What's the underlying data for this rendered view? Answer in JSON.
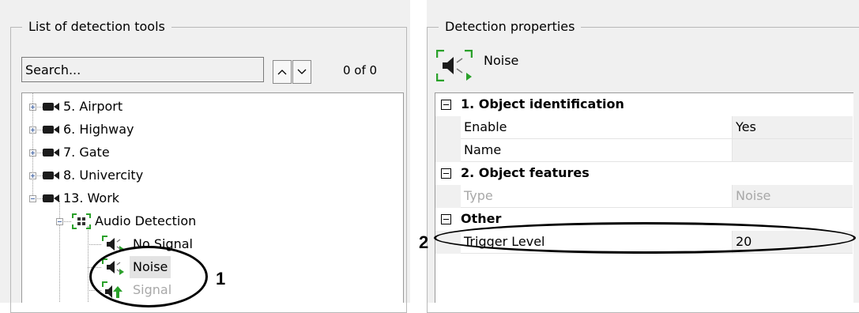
{
  "left_panel": {
    "title": "List of detection tools",
    "search_placeholder": "Search...",
    "up_arrow": "^",
    "down_arrow": "v",
    "result_count": "0 of 0",
    "tree": [
      {
        "label": "5. Airport",
        "expander": "plus",
        "icon": "camera-icon"
      },
      {
        "label": "6. Highway",
        "expander": "plus",
        "icon": "camera-icon"
      },
      {
        "label": "7. Gate",
        "expander": "plus",
        "icon": "camera-icon"
      },
      {
        "label": "8. Univercity",
        "expander": "plus",
        "icon": "camera-icon"
      },
      {
        "label": "13. Work",
        "expander": "minus",
        "icon": "camera-icon"
      },
      {
        "label": "Audio Detection",
        "expander": "minus",
        "icon": "audio-detection-icon"
      },
      {
        "label": "No Signal",
        "icon": "no-signal-speaker-icon"
      },
      {
        "label": "Noise",
        "icon": "noise-speaker-icon",
        "selected": true
      },
      {
        "label": "Signal",
        "icon": "signal-speaker-icon",
        "disabled": true
      }
    ]
  },
  "right_panel": {
    "title": "Detection properties",
    "header_label": "Noise",
    "header_icon": "noise-detector-icon",
    "categories": [
      {
        "label": "1. Object identification",
        "rows": [
          {
            "name": "Enable",
            "value": "Yes"
          },
          {
            "name": "Name",
            "value": ""
          }
        ]
      },
      {
        "label": "2. Object features",
        "rows": [
          {
            "name": "Type",
            "value": "Noise",
            "disabled": true
          }
        ]
      },
      {
        "label": "Other",
        "rows": [
          {
            "name": "Trigger Level",
            "value": "20"
          }
        ]
      }
    ]
  },
  "annotations": {
    "callout_1": "1",
    "callout_2": "2"
  },
  "colors": {
    "panel_bg": "#f0f0f0",
    "selection_bg": "#e3e3e3",
    "disabled_text": "#a8a8a8",
    "icon_green": "#2aa12a"
  }
}
